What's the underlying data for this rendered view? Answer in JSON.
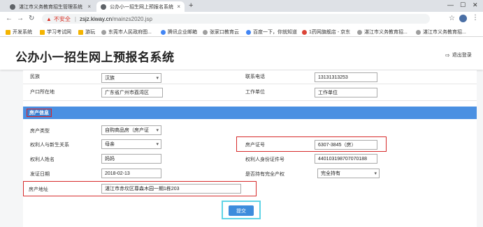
{
  "browser": {
    "tabs": [
      {
        "title": "湛江市义务教育招生管理系统"
      },
      {
        "title": "公办小一招生网上预报名系统"
      }
    ],
    "new_tab": "+",
    "insecure_label": "不安全",
    "url_host": "zsjz.kiway.cn",
    "url_path": "/mainzs2020.jsp",
    "bookmarks": [
      "开发系统",
      "学习考试网",
      "游玩",
      "东莞市人民政府图...",
      "腾讯企业邮箱",
      "张家口教育云",
      "百度一下，你就知道",
      "1药网旗舰店 - 京东",
      "湛江市义务教育招...",
      "湛江市义务教育招..."
    ]
  },
  "header": {
    "title": "公办小一招生网上预报名系统",
    "logout": "退出登录"
  },
  "form": {
    "ethnicity_label": "民族",
    "ethnicity_value": "汉族",
    "phone_label": "联系电话",
    "phone_value": "13131313253",
    "hukou_label": "户口所在地",
    "hukou_value": "广东省广州市荔湾区",
    "work_label": "工作单位",
    "work_value": "工作单位",
    "section_title": "房产信息",
    "property_type_label": "房产类型",
    "property_type_value": "自购商品房（房产证",
    "relation_label": "权利人与新生关系",
    "relation_value": "母亲",
    "cert_label": "房产证号",
    "cert_value": "6307-3845（房）",
    "owner_name_label": "权利人姓名",
    "owner_name_value": "妈妈",
    "owner_id_label": "权利人身份证件号",
    "owner_id_value": "440103198707070188",
    "issue_date_label": "发证日期",
    "issue_date_value": "2018-02-13",
    "full_ownership_label": "是否持有完全产权",
    "full_ownership_value": "完全持有",
    "address_label": "房产地址",
    "address_value": "湛江市赤坎区尊森木园一期1栋203",
    "submit_label": "提交"
  }
}
